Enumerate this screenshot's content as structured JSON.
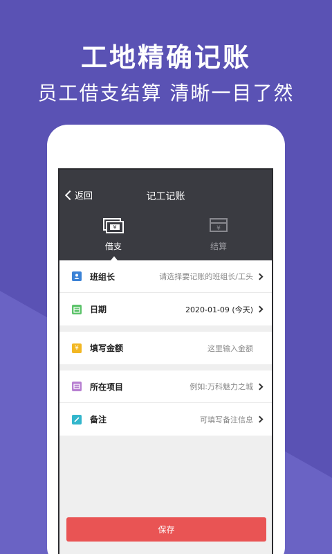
{
  "promo": {
    "headline": "工地精确记账",
    "subline": "员工借支结算 清晰一目了然"
  },
  "nav": {
    "back_label": "返回",
    "title": "记工记账"
  },
  "tabs": [
    {
      "label": "借支",
      "icon": "cash-icon",
      "active": true
    },
    {
      "label": "结算",
      "icon": "settlement-icon",
      "active": false
    }
  ],
  "form": {
    "group1": [
      {
        "icon": "person-icon",
        "icon_color": "#3b82d6",
        "label": "班组长",
        "value": "请选择要记账的班组长/工头"
      },
      {
        "icon": "calendar-icon",
        "icon_color": "#5cc36a",
        "label": "日期",
        "value": "2020-01-09 (今天)"
      }
    ],
    "group2": [
      {
        "icon": "yen-icon",
        "icon_color": "#f2b723",
        "label": "填写金额",
        "value": "这里输入金额"
      }
    ],
    "group3": [
      {
        "icon": "project-icon",
        "icon_color": "#b77fd1",
        "label": "所在项目",
        "value": "例如:万科魅力之城"
      },
      {
        "icon": "pencil-icon",
        "icon_color": "#33b6cc",
        "label": "备注",
        "value": "可填写备注信息"
      }
    ]
  },
  "save_label": "保存",
  "colors": {
    "background": "#5a52b4",
    "topbar": "#3a3b41",
    "save_button": "#e95454"
  }
}
